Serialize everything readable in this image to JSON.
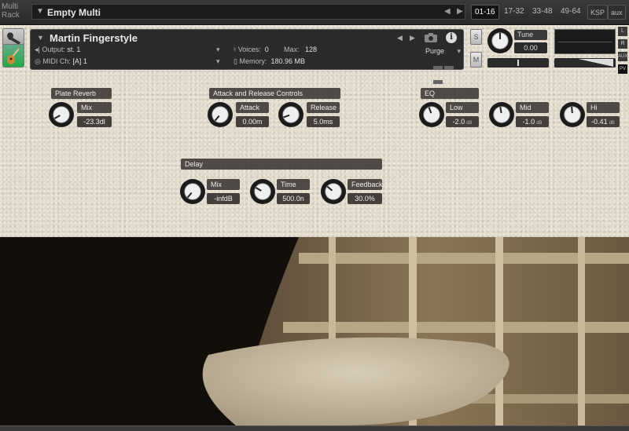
{
  "multi": {
    "label": "Multi\nRack",
    "name": "Empty Multi",
    "pages": [
      "01-16",
      "17-32",
      "33-48",
      "49-64"
    ],
    "ksp": "KSP",
    "aux": "aux"
  },
  "instrument": {
    "title": "Martin Fingerstyle",
    "output_label": "Output:",
    "output_value": "st. 1",
    "voices_label": "Voices:",
    "voices_value": "0",
    "max_label": "Max:",
    "max_value": "128",
    "purge": "Purge",
    "midi_label": "MIDI Ch:",
    "midi_value": "[A]  1",
    "memory_label": "Memory:",
    "memory_value": "180.96 MB",
    "info": "i"
  },
  "side": {
    "solo": "S",
    "mute": "M",
    "tune_label": "Tune",
    "tune_value": "0.00",
    "l": "L",
    "r": "R",
    "aux": "AUX",
    "pv": "PV"
  },
  "sections": {
    "reverb": {
      "title": "Plate Reverb",
      "knobs": [
        {
          "label": "Mix",
          "value": "-23.3dl"
        }
      ]
    },
    "attack_release": {
      "title": "Attack and Release Controls",
      "knobs": [
        {
          "label": "Attack",
          "value": "0.00m"
        },
        {
          "label": "Release",
          "value": "5.0ms"
        }
      ]
    },
    "eq": {
      "title": "EQ",
      "knobs": [
        {
          "label": "Low",
          "value": "-2.0",
          "unit": "dB"
        },
        {
          "label": "Mid",
          "value": "-1.0",
          "unit": "dB"
        },
        {
          "label": "Hi",
          "value": "-0.41",
          "unit": "dB"
        }
      ]
    },
    "delay": {
      "title": "Delay",
      "knobs": [
        {
          "label": "Mix",
          "value": "-infdB"
        },
        {
          "label": "Time",
          "value": "500.0n"
        },
        {
          "label": "Feedback",
          "value": "30.0%"
        }
      ]
    }
  }
}
